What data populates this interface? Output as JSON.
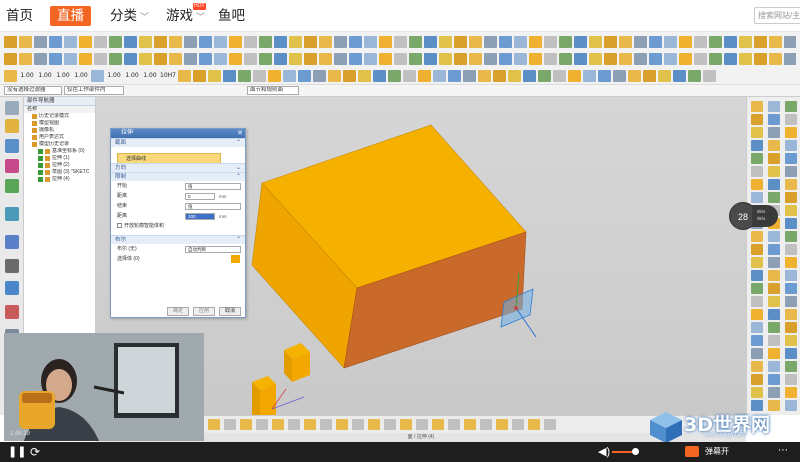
{
  "topnav": {
    "items": [
      "首页",
      "直播",
      "分类",
      "游戏",
      "鱼吧"
    ],
    "hot_badge": "HOT",
    "search_placeholder": "搜索网站/主播"
  },
  "toolbar_numbers": [
    "1.00",
    "1.00",
    "1.00",
    "1.00",
    "1.00",
    "1.00",
    "1.00",
    "10H7"
  ],
  "selection_bar": {
    "filter_value": "没有选择过滤器",
    "scope_value": "仅在工作部件内",
    "snap_value": "面节和规则面"
  },
  "part_navigator": {
    "title": "部件导航器",
    "header": "名称",
    "items": [
      {
        "label": "历史记录模式",
        "checked": false
      },
      {
        "label": "模型视图",
        "checked": false
      },
      {
        "label": "摄像机",
        "checked": false
      },
      {
        "label": "用户表达式",
        "checked": false
      },
      {
        "label": "模型历史记录",
        "checked": false
      },
      {
        "label": "基准坐标系 (0)",
        "checked": true
      },
      {
        "label": "拉伸 (1)",
        "checked": true
      },
      {
        "label": "拉伸 (2)",
        "checked": true
      },
      {
        "label": "草图 (3) \"SKETC",
        "checked": true
      },
      {
        "label": "拉伸 (4)",
        "checked": true
      }
    ]
  },
  "extrude_dialog": {
    "title": "拉伸",
    "sec_section": "截面",
    "select_curve": "选择曲线",
    "sec_direction": "方向",
    "sec_limits": "限制",
    "start_label": "开始",
    "start_value": "值",
    "distance_label": "距离",
    "distance_value": "0",
    "end_label": "结束",
    "end_value": "值",
    "distance2_label": "距离",
    "distance2_value": "100",
    "unit": "mm",
    "open_profile": "开放轮廓智能体积",
    "sec_boolean": "布尔",
    "boolean_label": "布尔 (无)",
    "boolean_value": "自动判断",
    "select_body": "选择体 (0)",
    "btn_ok": "确定",
    "btn_apply": "应用",
    "btn_cancel": "取消"
  },
  "status_text": "面 / 拉伸 (4)",
  "cam_timestamp": "1:46:29",
  "gauge": {
    "value": "28",
    "up": "0k/s",
    "down": "0k/s"
  },
  "player": {
    "danmu_label": "弹幕开",
    "volume_level": 0.75
  },
  "watermark": {
    "title": "3D世界网",
    "sub": "www.3dsjw.com"
  }
}
